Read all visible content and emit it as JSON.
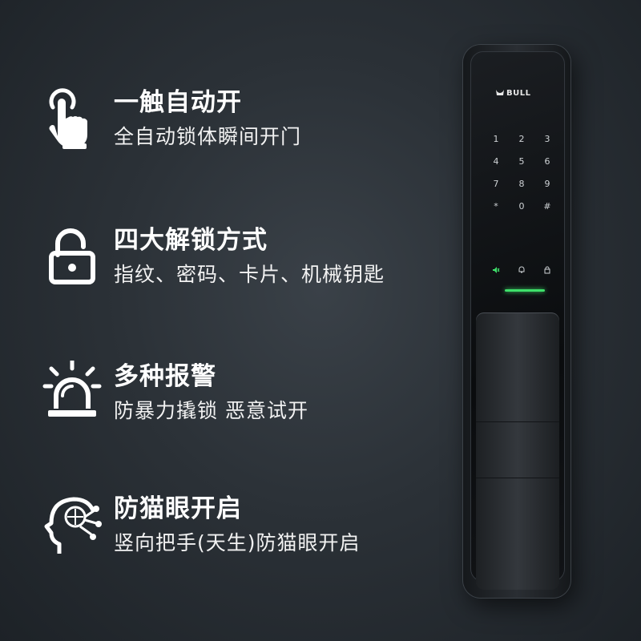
{
  "features": [
    {
      "icon": "hand-pointer-icon",
      "title": "一触自动开",
      "desc": "全自动锁体瞬间开门"
    },
    {
      "icon": "padlock-icon",
      "title": "四大解锁方式",
      "desc": "指纹、密码、卡片、机械钥匙"
    },
    {
      "icon": "alarm-siren-icon",
      "title": "多种报警",
      "desc": "防暴力撬锁 恶意试开"
    },
    {
      "icon": "ai-head-icon",
      "title": "防猫眼开启",
      "desc": "竖向把手(天生)防猫眼开启"
    }
  ],
  "lock": {
    "brand": "BULL",
    "keypad": [
      "1",
      "2",
      "3",
      "4",
      "5",
      "6",
      "7",
      "8",
      "9",
      "*",
      "0",
      "#"
    ],
    "accent_color": "#3ee06a"
  }
}
